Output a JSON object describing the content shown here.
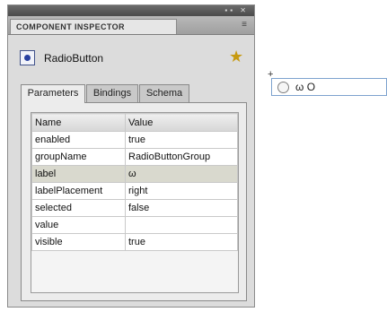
{
  "panel": {
    "title": "COMPONENT INSPECTOR",
    "window_buttons": "▪▪ ✕",
    "menu_glyph": "≡",
    "component_name": "RadioButton",
    "component_icon": "radio-button-icon",
    "help_icon": "help-icon"
  },
  "tabs": [
    {
      "label": "Parameters",
      "active": true
    },
    {
      "label": "Bindings",
      "active": false
    },
    {
      "label": "Schema",
      "active": false
    }
  ],
  "grid": {
    "headers": [
      "Name",
      "Value"
    ],
    "rows": [
      {
        "name": "enabled",
        "value": "true"
      },
      {
        "name": "groupName",
        "value": "RadioButtonGroup"
      },
      {
        "name": "label",
        "value": "ω",
        "selected": true
      },
      {
        "name": "labelPlacement",
        "value": "right"
      },
      {
        "name": "selected",
        "value": "false"
      },
      {
        "name": "value",
        "value": ""
      },
      {
        "name": "visible",
        "value": "true"
      }
    ]
  },
  "stage": {
    "radio_label": "ω O",
    "registration_mark": "+"
  },
  "colors": {
    "panel_bg": "#dcdcdc",
    "selected_row": "#d9d9ce",
    "stage_outline": "#7da2ce"
  }
}
